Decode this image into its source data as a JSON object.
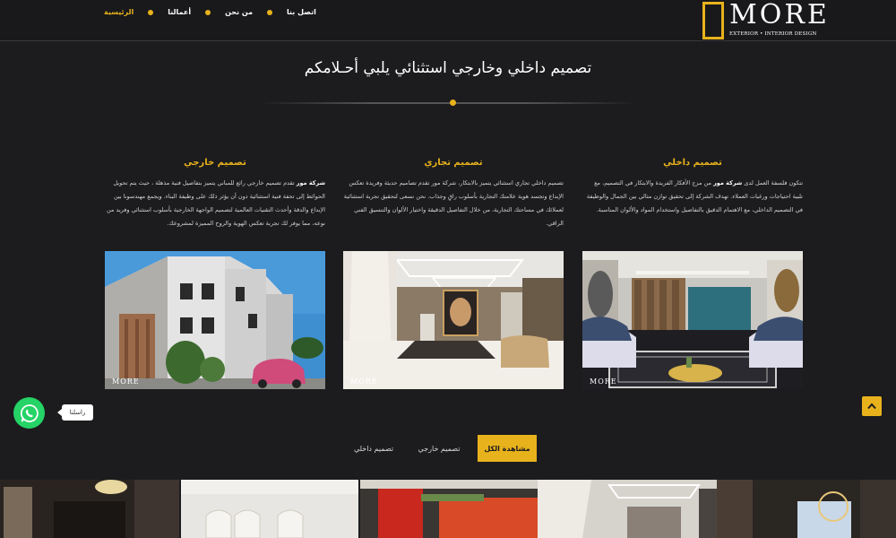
{
  "header": {
    "logo_text": "MORE",
    "logo_subtitle": "EXTERIOR • INTERIOR DESIGN",
    "nav": [
      {
        "label": "الرئيسية",
        "active": true
      },
      {
        "label": "أعمالنا",
        "active": false
      },
      {
        "label": "من نحن",
        "active": false
      },
      {
        "label": "اتصل بنا",
        "active": false
      }
    ]
  },
  "hero": {
    "title": "تصميم داخلي وخارجي استثنائي يلبي أحـلامكم"
  },
  "services": [
    {
      "title": "تصميم داخلي",
      "text_before": "تتكون فلسفة العمل لدى ",
      "text_bold": "شركة مور",
      "text_after": " من مزج الأفكار الفريدة والابتكار في التصميم، مع تلبية احتياجات ورغبات العملاء. تهدف الشركة إلى تحقيق توازن مثالي بين الجمال والوظيفة في التصميم الداخلي، مع الاهتمام الدقيق بالتفاصيل واستخدام المواد والألوان المناسبة.",
      "image": "interior-living-room-photo"
    },
    {
      "title": "تصميم تجاري",
      "text_before": "تصميم داخلي تجاري استثنائي يتميز بالابتكار، شركة مور تقدم تصاميم حديثة وفريدة تعكس الإبداع وتجسد هوية علامتك التجارية بأسلوب راقٍ وجذاب. نحن نسعى لتحقيق تجربة استثنائية لعملائك في مساحتك التجارية، من خلال التفاصيل الدقيقة واختيار الألوان والتنسيق الفني الراقي.",
      "text_bold": "",
      "text_after": "",
      "image": "commercial-showroom-photo"
    },
    {
      "title": "تصميم خارجي",
      "text_before": "",
      "text_bold": "شركة مور",
      "text_after": " تقدم تصميم خارجي رائع للمباني يتميز بتفاصيل فنية مذهلة ، حيث يتم تحويل الحوائط إلى تحفة فنية استثنائية دون أن يؤثر ذلك على وظيفة البناء. ويجمع مهندسونا بين الإبداع والدقة وأحدث التقنيات العالمية لتصميم الواجهة الخارجية بأسلوب استثنائي وفريد من نوعه، مما يوفر لك تجربة تعكس الهوية والروح المميزة لمشروعك.",
      "image": "exterior-villa-photo"
    }
  ],
  "photo_watermark": "MORE",
  "whatsapp": {
    "label": "راسلنا"
  },
  "filters": [
    {
      "label": "مشاهدة الكل",
      "active": true
    },
    {
      "label": "تصميم خارجي",
      "active": false
    },
    {
      "label": "تصميم داخلي",
      "active": false
    }
  ],
  "colors": {
    "accent": "#e8b21c",
    "background": "#1c1c1e",
    "whatsapp": "#25d366"
  }
}
